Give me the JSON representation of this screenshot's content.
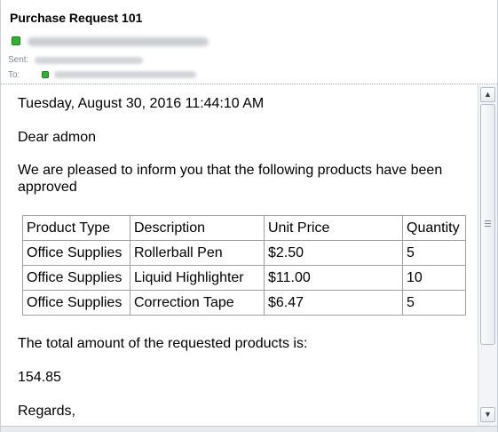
{
  "message": {
    "subject": "Purchase Request 101",
    "sent_label": "Sent:",
    "to_label": "To:"
  },
  "body": {
    "date": "Tuesday, August 30, 2016 11:44:10 AM",
    "greeting": "Dear admon",
    "intro": "We are pleased to inform you that the following products have been approved",
    "table": {
      "headers": [
        "Product Type",
        "Description",
        "Unit Price",
        "Quantity"
      ],
      "rows": [
        [
          "Office Supplies",
          "Rollerball Pen",
          "$2.50",
          "5"
        ],
        [
          "Office Supplies",
          "Liquid Highlighter",
          "$11.00",
          "10"
        ],
        [
          "Office Supplies",
          "Correction Tape",
          "$6.47",
          "5"
        ]
      ]
    },
    "total_label": "The total amount of the requested products is:",
    "total_value": "154.85",
    "closing": "Regards,"
  },
  "scrollbar": {
    "up_icon": "▲",
    "down_icon": "▼"
  },
  "colors": {
    "presence_online": "#2fb52a",
    "table_border": "#a0a0a0"
  }
}
